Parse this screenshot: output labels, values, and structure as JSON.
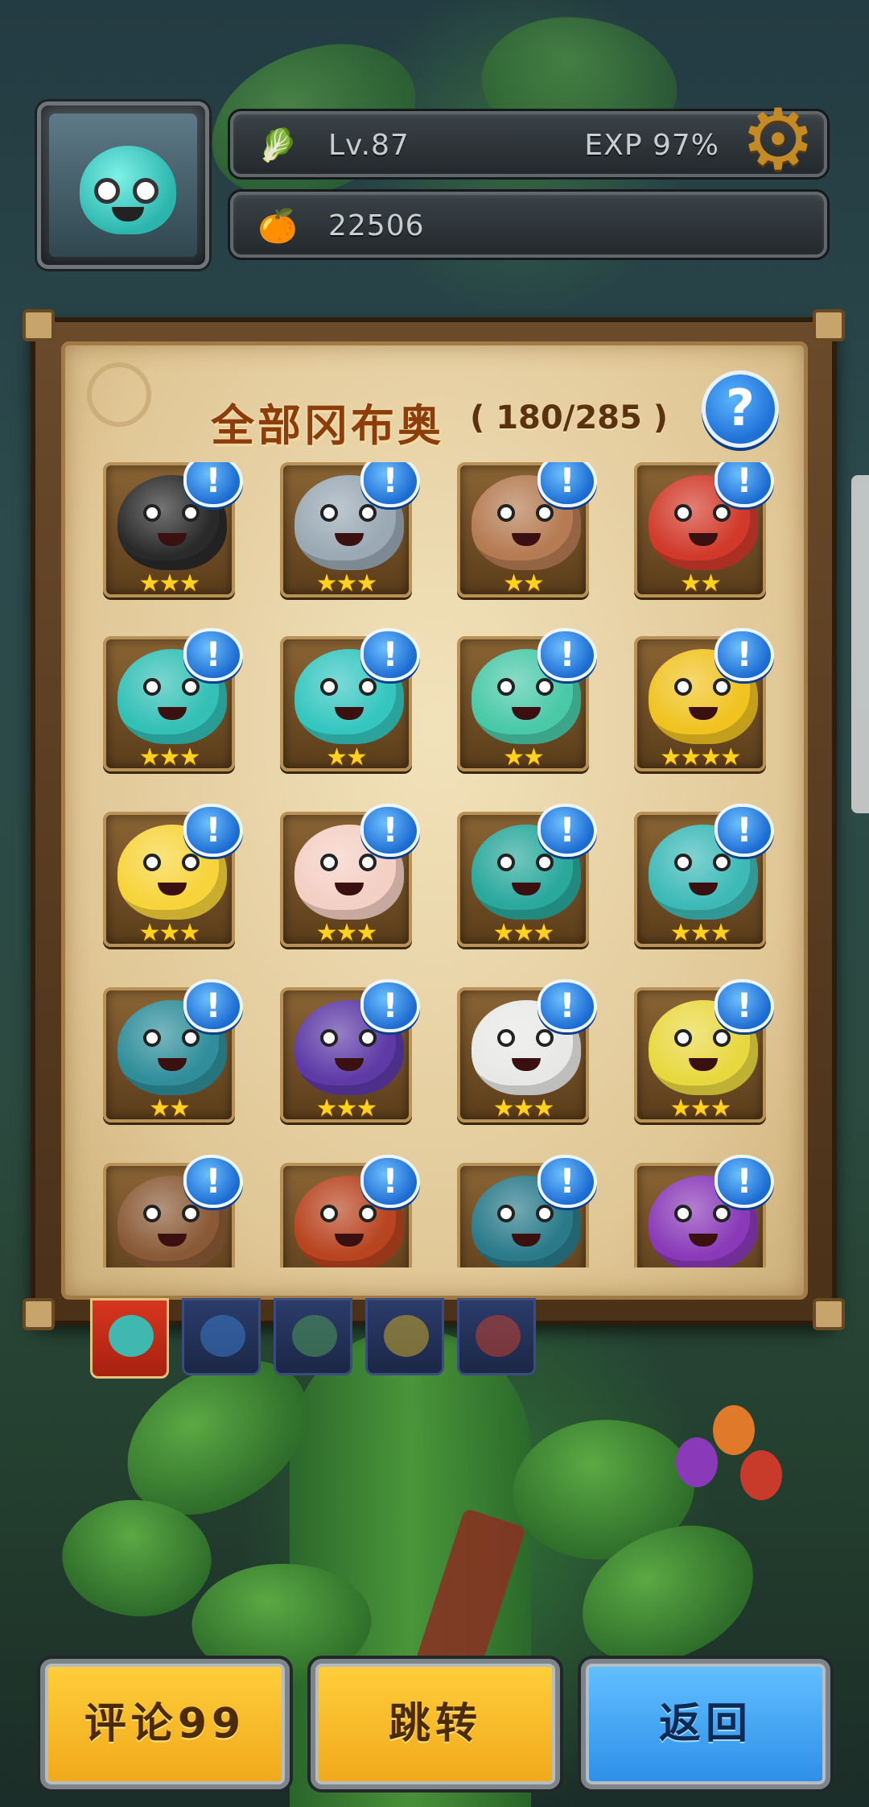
{
  "hud": {
    "level": "Lv.87",
    "exp": "EXP 97%",
    "coins": "22506",
    "level_icon": "cabbage-icon",
    "coin_icon": "fruit-icon",
    "settings_icon": "gear-icon"
  },
  "collection": {
    "title": "全部冈布奥",
    "count": "( 180/285 )",
    "help_label": "?",
    "badge_label": "!",
    "items": [
      {
        "color": "#2a2a2a",
        "stars": "★★★"
      },
      {
        "color": "#9aa9b4",
        "stars": "★★★"
      },
      {
        "color": "#b57b52",
        "stars": "★★"
      },
      {
        "color": "#d13a2a",
        "stars": "★★"
      },
      {
        "color": "#33c0b6",
        "stars": "★★★"
      },
      {
        "color": "#36c6c0",
        "stars": "★★"
      },
      {
        "color": "#49c9a8",
        "stars": "★★"
      },
      {
        "color": "#f0c321",
        "stars": "★★★★"
      },
      {
        "color": "#f7d43a",
        "stars": "★★★"
      },
      {
        "color": "#f4cfc4",
        "stars": "★★★"
      },
      {
        "color": "#2aa89c",
        "stars": "★★★"
      },
      {
        "color": "#3dbab8",
        "stars": "★★★"
      },
      {
        "color": "#2f8e9a",
        "stars": "★★"
      },
      {
        "color": "#5d3aa6",
        "stars": "★★★"
      },
      {
        "color": "#e8e8e6",
        "stars": "★★★"
      },
      {
        "color": "#e8d840",
        "stars": "★★★"
      },
      {
        "color": "#8a5a36",
        "stars": ""
      },
      {
        "color": "#b84420",
        "stars": ""
      },
      {
        "color": "#2a7a8a",
        "stars": ""
      },
      {
        "color": "#8a3ab8",
        "stars": ""
      }
    ]
  },
  "tabs": [
    {
      "name": "all",
      "color": "#3fb8b0",
      "active": true
    },
    {
      "name": "blue",
      "color": "#3b7ac8",
      "active": false
    },
    {
      "name": "green",
      "color": "#4f9a5a",
      "active": false
    },
    {
      "name": "gold",
      "color": "#c9a72a",
      "active": false
    },
    {
      "name": "red",
      "color": "#c2412d",
      "active": false
    }
  ],
  "buttons": {
    "comment": "评论99",
    "jump": "跳转",
    "back": "返回"
  }
}
